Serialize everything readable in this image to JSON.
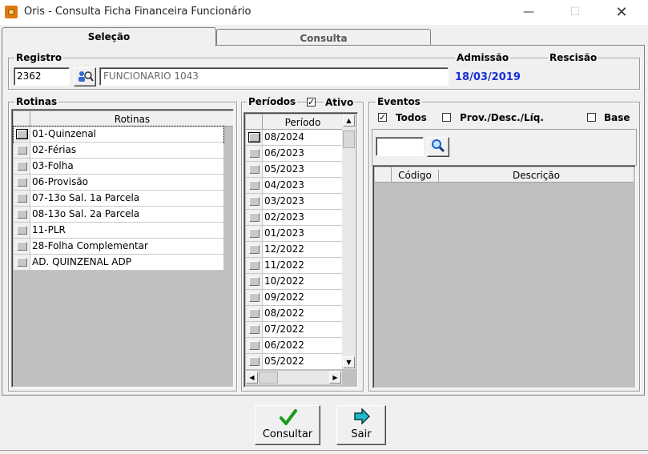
{
  "window": {
    "title": "Oris - Consulta Ficha Financeira Funcionário"
  },
  "tabs": [
    {
      "label": "Seleção"
    },
    {
      "label": "Consulta"
    }
  ],
  "registro": {
    "title": "Registro",
    "value": "2362",
    "name": "FUNCIONARIO 1043",
    "admissao_label": "Admissão",
    "admissao_value": "18/03/2019",
    "rescisao_label": "Rescisão"
  },
  "rotinas": {
    "title": "Rotinas",
    "header": "Rotinas",
    "items": [
      "01-Quinzenal",
      "02-Férias",
      "03-Folha",
      "06-Provisão",
      "07-13o Sal. 1a Parcela",
      "08-13o Sal. 2a Parcela",
      "11-PLR",
      "28-Folha Complementar",
      "AD. QUINZENAL ADP"
    ]
  },
  "periodos": {
    "title": "Períodos",
    "ativo_label": "Ativo",
    "ativo_checked": true,
    "header": "Período",
    "items": [
      "08/2024",
      "06/2023",
      "05/2023",
      "04/2023",
      "03/2023",
      "02/2023",
      "01/2023",
      "12/2022",
      "11/2022",
      "10/2022",
      "09/2022",
      "08/2022",
      "07/2022",
      "06/2022",
      "05/2022"
    ]
  },
  "eventos": {
    "title": "Eventos",
    "todos_label": "Todos",
    "todos_checked": true,
    "prov_label": "Prov./Desc./Líq.",
    "base_label": "Base",
    "search_value": "",
    "col_codigo": "Código",
    "col_descricao": "Descrição"
  },
  "buttons": {
    "consultar": "Consultar",
    "sair": "Sair"
  },
  "colors": {
    "accent_date": "#1a2fd0",
    "check_green": "#1a9a1a",
    "arrow_cyan": "#20b8c8"
  }
}
